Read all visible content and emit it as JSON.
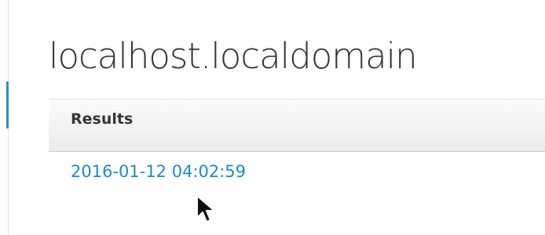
{
  "page": {
    "title": "localhost.localdomain"
  },
  "results": {
    "header": "Results",
    "items": [
      {
        "label": "2016-01-12 04:02:59"
      }
    ]
  },
  "colors": {
    "link": "#1d8ac9",
    "accent": "#2a8fc8",
    "title_text": "#333333"
  },
  "icons": {
    "cursor": "mouse-pointer-icon"
  }
}
